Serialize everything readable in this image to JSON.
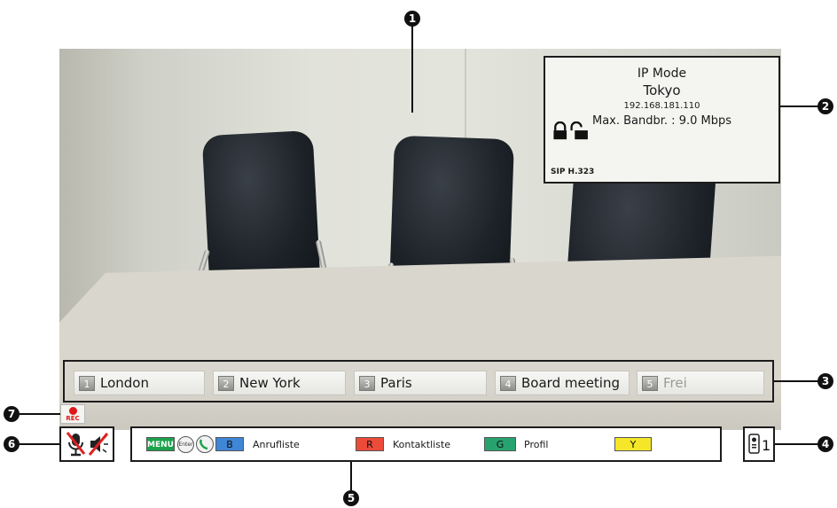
{
  "info_panel": {
    "mode": "IP Mode",
    "site_name": "Tokyo",
    "ip_address": "192.168.181.110",
    "bandwidth": "Max. Bandbr. : 9.0 Mbps",
    "protocols": "SIP H.323",
    "icons": [
      "lock-closed-icon",
      "lock-open-icon"
    ]
  },
  "speed_dial": [
    {
      "number": "1",
      "label": "London"
    },
    {
      "number": "2",
      "label": "New York"
    },
    {
      "number": "3",
      "label": "Paris"
    },
    {
      "number": "4",
      "label": "Board meeting"
    },
    {
      "number": "5",
      "label": "Frei"
    }
  ],
  "recording": {
    "label": "REC",
    "color": "#e01818"
  },
  "mic_status": {
    "icons": [
      "mic-muted-icon",
      "speaker-muted-icon"
    ]
  },
  "guide_bar": {
    "menu_key": "MENU",
    "enter_key": "Enter",
    "call_history_key": "B",
    "call_history_label": "Anrufliste",
    "contacts_key": "R",
    "contacts_label": "Kontaktliste",
    "profile_key": "G",
    "profile_label": "Profil",
    "yellow_key": "Y",
    "colors": {
      "menu": "#1aa34a",
      "blue": "#3f86d6",
      "red": "#ec4b3a",
      "green": "#28a36f",
      "yellow": "#f5e62a"
    }
  },
  "remote": {
    "id": "1",
    "icon": "remote-control-icon"
  },
  "callouts": [
    "1",
    "2",
    "3",
    "4",
    "5",
    "6",
    "7"
  ]
}
